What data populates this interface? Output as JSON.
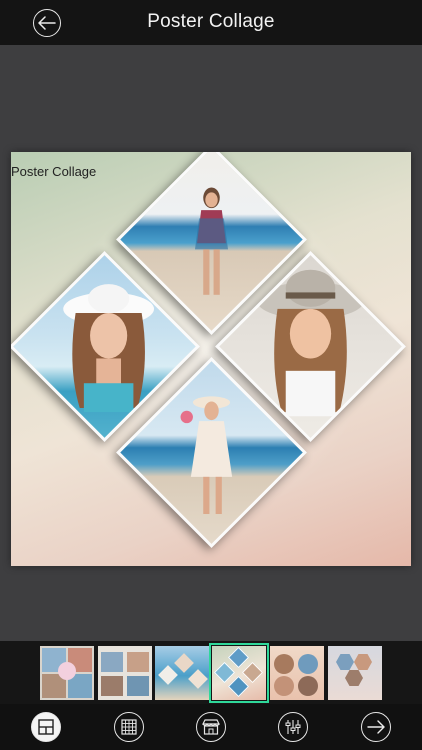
{
  "header": {
    "title": "Poster Collage",
    "back_icon": "arrow-left-icon"
  },
  "canvas": {
    "label": "Poster Collage",
    "layout": "four-diamond",
    "photos": [
      {
        "position": "top",
        "subject": "woman on beach in floral dress"
      },
      {
        "position": "left",
        "subject": "woman in white sun hat portrait"
      },
      {
        "position": "right",
        "subject": "woman in hat smiling"
      },
      {
        "position": "bottom",
        "subject": "woman in white dress with lollipop"
      }
    ]
  },
  "templates": {
    "count": 6,
    "selected_index": 3
  },
  "toolbar": {
    "items": [
      {
        "icon": "layout-grid-icon",
        "active": true
      },
      {
        "icon": "pattern-grid-icon",
        "active": false
      },
      {
        "icon": "sticker-shop-icon",
        "active": false
      },
      {
        "icon": "sliders-adjust-icon",
        "active": false
      },
      {
        "icon": "arrow-right-icon",
        "active": false
      }
    ]
  },
  "colors": {
    "accent": "#2fd89a",
    "topbar": "#141414",
    "background": "#3e3e40"
  }
}
